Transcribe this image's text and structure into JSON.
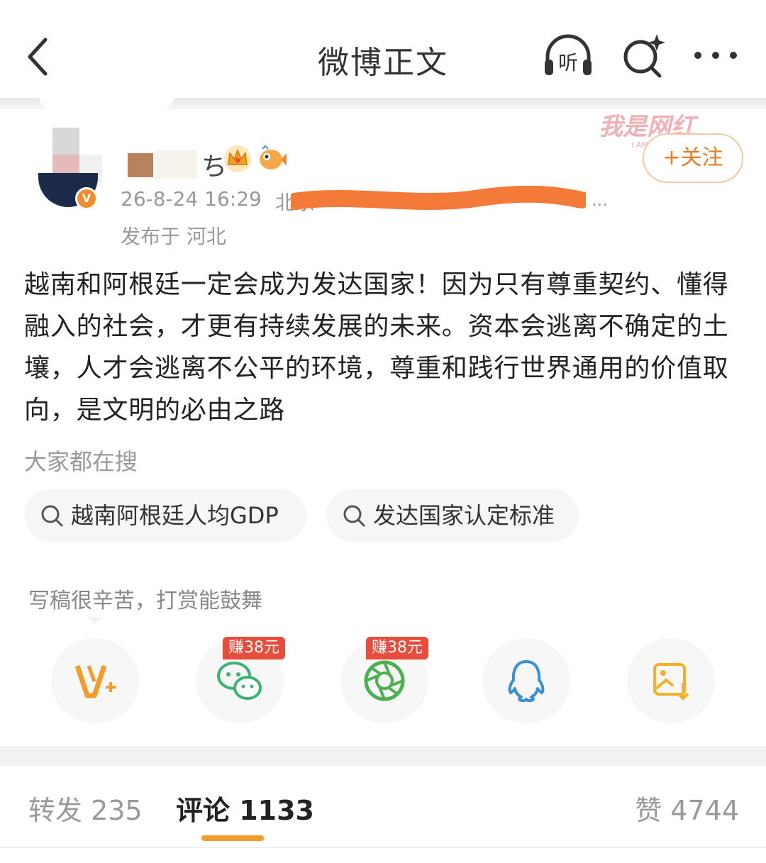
{
  "header": {
    "title": "微博正文",
    "listen_label": "听",
    "icons": [
      "back-arrow-icon",
      "listen-headphones-icon",
      "search-sparkle-icon",
      "more-dots-icon"
    ]
  },
  "post": {
    "author_name_fragment": "ち",
    "timestamp": "26-8-24 16:29",
    "source": "北京",
    "ellipsis": "...",
    "location": "发布于 河北",
    "follow_label": "+关注",
    "watermark_text": "我是网红",
    "watermark_small": "I AM",
    "body": "越南和阿根廷一定会成为发达国家！因为只有尊重契约、懂得融入的社会，才更有持续发展的未来。资本会逃离不确定的土壤，人才会逃离不公平的环境，尊重和践行世界通用的价值取向，是文明的必由之路"
  },
  "search": {
    "title": "大家都在搜",
    "chips": [
      "越南阿根廷人均GDP",
      "发达国家认定标准"
    ]
  },
  "reward": {
    "tip": "写稿很辛苦，打赏能鼓舞"
  },
  "share": {
    "items": [
      "reward-v-plus-icon",
      "wechat-icon",
      "moments-icon",
      "qq-icon",
      "save-image-icon"
    ],
    "earn_badges": [
      "赚38元",
      "赚38元"
    ]
  },
  "tabs": {
    "repost": "转发 235",
    "comment": "评论 1133",
    "like": "赞 4744"
  },
  "colors": {
    "accent": "#f39c2b",
    "follow": "#f07a1e",
    "earn_badge": "#e84c3d",
    "redaction": "#f47a3a"
  }
}
